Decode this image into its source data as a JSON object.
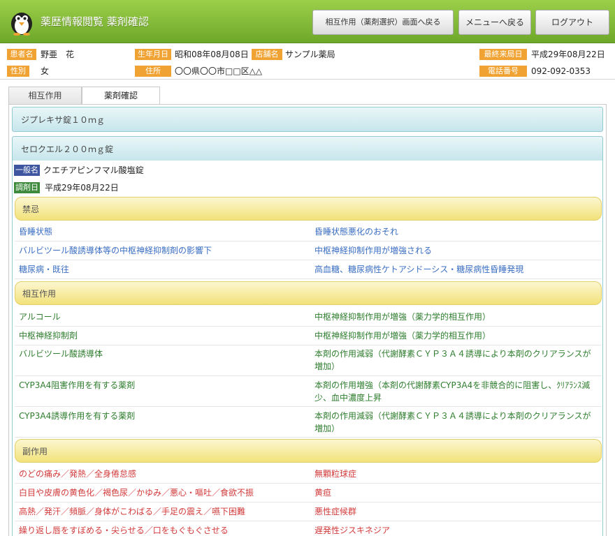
{
  "header": {
    "title": "薬歴情報閲覧 薬剤確認",
    "buttons": {
      "interaction": "相互作用（薬剤選択）画面へ戻る",
      "menu": "メニューへ戻る",
      "logout": "ログアウト"
    }
  },
  "patient": {
    "labels": {
      "name": "患者名",
      "sex": "性別",
      "birth": "生年月日",
      "address": "住所",
      "store": "店舗名",
      "last_visit": "最終来局日",
      "phone": "電話番号"
    },
    "name": "野亜　花",
    "sex": "女",
    "birth": "昭和08年08月08日",
    "address": "〇〇県〇〇市□□区△△",
    "store": "サンプル薬局",
    "last_visit": "平成29年08月22日",
    "phone": "092-092-0353"
  },
  "tabs": [
    "相互作用",
    "薬剤確認"
  ],
  "drugs": [
    {
      "name": "ジプレキサ錠１０ｍｇ"
    },
    {
      "name": "セロクエル２００ｍｇ錠",
      "generic_label": "一般名",
      "generic_value": "クエチアピンフマル酸塩錠",
      "date_label": "調剤日",
      "date_value": "平成29年08月22日"
    }
  ],
  "sections": {
    "contra": {
      "title": "禁忌",
      "rows": [
        {
          "left": "昏睡状態",
          "right": "昏睡状態悪化のおそれ"
        },
        {
          "left": "バルビツール酸誘導体等の中枢神経抑制剤の影響下",
          "right": "中枢神経抑制作用が増強される"
        },
        {
          "left": "糖尿病・既往",
          "right": "高血糖、糖尿病性ケトアシドーシス・糖尿病性昏睡発現"
        }
      ]
    },
    "interaction": {
      "title": "相互作用",
      "rows": [
        {
          "left": "アルコール",
          "right": "中枢神経抑制作用が増強（薬力学的相互作用）"
        },
        {
          "left": "中枢神経抑制剤",
          "right": "中枢神経抑制作用が増強（薬力学的相互作用）"
        },
        {
          "left": "バルビツール酸誘導体",
          "right": "本剤の作用減弱（代謝酵素ＣＹＰ３Ａ４誘導により本剤のクリアランスが増加）"
        },
        {
          "left": "CYP3A4阻害作用を有する薬剤",
          "right": "本剤の作用増強（本剤の代謝酵素CYP3A4を非競合的に阻害し、ｸﾘｱﾗﾝｽ減少、血中濃度上昇"
        },
        {
          "left": "CYP3A4誘導作用を有する薬剤",
          "right": "本剤の作用減弱（代謝酵素ＣＹＰ３Ａ４誘導により本剤のクリアランスが増加）"
        }
      ]
    },
    "side": {
      "title": "副作用",
      "rows": [
        {
          "left": "のどの痛み／発熱／全身倦怠感",
          "right": "無顆粒球症"
        },
        {
          "left": "白目や皮膚の黄色化／褐色尿／かゆみ／悪心・嘔吐／食欲不振",
          "right": "黄疸"
        },
        {
          "left": "高熱／発汗／頻脈／身体がこわばる／手足の震え／嚥下困難",
          "right": "悪性症候群"
        },
        {
          "left": "繰り返し唇をすぼめる・尖らせる／口をもぐもぐさせる",
          "right": "遅発性ジスキネジア"
        }
      ]
    }
  }
}
